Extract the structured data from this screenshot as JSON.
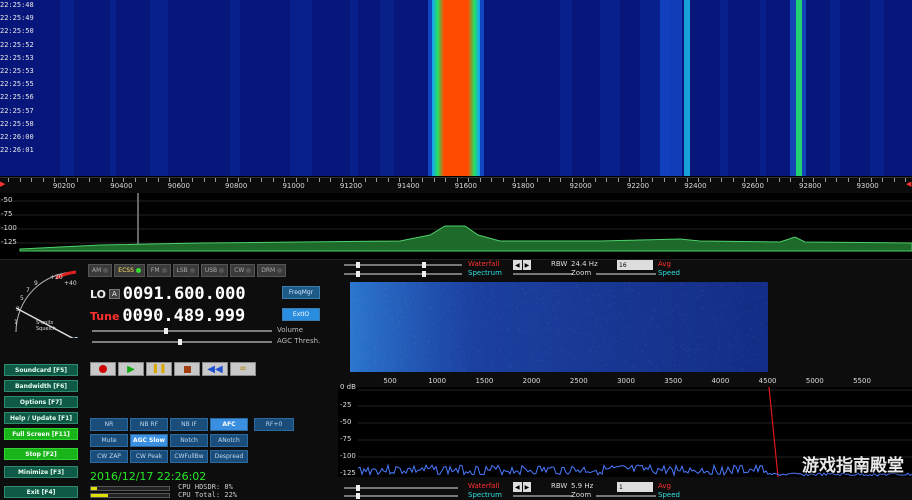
{
  "waterfall": {
    "timestamps": [
      "22:25:48",
      "22:25:49",
      "22:25:50",
      "22:25:52",
      "22:25:53",
      "22:25:53",
      "22:25:55",
      "22:25:56",
      "22:25:57",
      "22:25:58",
      "22:26:00",
      "22:26:01"
    ]
  },
  "freq_scale": {
    "labels": [
      "90200",
      "90400",
      "90600",
      "90800",
      "91000",
      "91200",
      "91400",
      "91600",
      "91800",
      "92000",
      "92200",
      "92400",
      "92600",
      "92800",
      "93000"
    ]
  },
  "spectrum": {
    "db_labels": [
      "-50",
      "-75",
      "-100",
      "-125"
    ]
  },
  "modes": [
    {
      "label": "AM",
      "on": false
    },
    {
      "label": "ECSS",
      "on": true
    },
    {
      "label": "FM",
      "on": false
    },
    {
      "label": "LSB",
      "on": false
    },
    {
      "label": "USB",
      "on": false
    },
    {
      "label": "CW",
      "on": false
    },
    {
      "label": "DRM",
      "on": false
    }
  ],
  "meter": {
    "scale_labels": [
      "1",
      "3",
      "5",
      "7",
      "9",
      "+20",
      "+40"
    ],
    "caption": "S-units Squelch"
  },
  "lo": {
    "label": "LO",
    "badge": "A",
    "value": "0091.600.000"
  },
  "tune": {
    "label": "Tune",
    "value": "0090.489.999"
  },
  "buttons": {
    "freqmgr": "FreqMgr",
    "extio": "ExtIO",
    "volume": "Volume",
    "agc_thresh": "AGC Thresh."
  },
  "func_buttons": [
    {
      "label": "Soundcard  [F5]"
    },
    {
      "label": "Bandwidth  [F6]"
    },
    {
      "label": "Options  [F7]"
    },
    {
      "label": "Help / Update  [F1]"
    },
    {
      "label": "Full Screen  [F11]",
      "green": true
    },
    {
      "label": "Stop  [F2]",
      "green": true
    },
    {
      "label": "Minimize  [F3]"
    },
    {
      "label": "Exit  [F4]"
    }
  ],
  "dsp": {
    "row1": [
      {
        "label": "NR"
      },
      {
        "label": "NB RF"
      },
      {
        "label": "NB IF"
      },
      {
        "label": "AFC",
        "on": true
      },
      {
        "label": "RF+0"
      }
    ],
    "row2": [
      {
        "label": "Mute"
      },
      {
        "label": "AGC Slow",
        "on": true
      },
      {
        "label": "Notch"
      },
      {
        "label": "ANotch"
      }
    ],
    "row3": [
      {
        "label": "CW ZAP"
      },
      {
        "label": "CW Peak"
      },
      {
        "label": "CWFullBw"
      },
      {
        "label": "Despread"
      }
    ]
  },
  "status": {
    "datetime": "2016/12/17 22:26:02",
    "cpu_hdsdr": "CPU HDSDR:  8%",
    "cpu_total": "CPU Total: 22%"
  },
  "af_top": {
    "waterfall": "Waterfall",
    "spectrum": "Spectrum",
    "rbw_label": "RBW",
    "rbw_value": "24.4 Hz",
    "zoom": "Zoom",
    "avg_value": "16",
    "avg": "Avg",
    "speed": "Speed"
  },
  "af_scale": [
    "500",
    "1000",
    "1500",
    "2000",
    "2500",
    "3000",
    "3500",
    "4000",
    "4500",
    "5000",
    "5500"
  ],
  "af_db_labels": [
    "0 dB",
    "-25",
    "-50",
    "-75",
    "-100",
    "-125"
  ],
  "af_bottom": {
    "waterfall": "Waterfall",
    "spectrum": "Spectrum",
    "rbw_label": "RBW",
    "rbw_value": "5.9 Hz",
    "zoom": "Zoom",
    "avg_value": "1",
    "avg": "Avg",
    "speed": "Speed"
  },
  "watermark": "游戏指南殿堂",
  "colors": {
    "signal": "#ff3a00",
    "waterfall_bg": "#05146e",
    "green": "#19b419",
    "accent_blue": "#3a8fe0"
  }
}
